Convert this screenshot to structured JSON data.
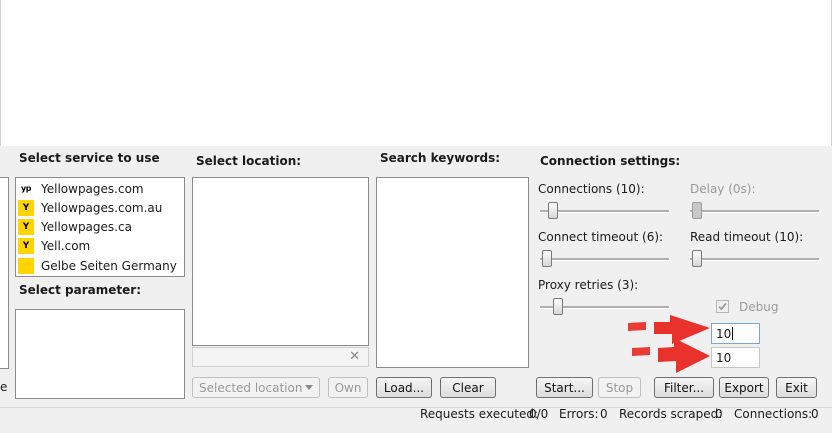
{
  "services": {
    "title": "Select service to use",
    "items": [
      {
        "label": "Yellowpages.com",
        "icon": "yellowpages-logo-icon",
        "glyph": "yp"
      },
      {
        "label": "Yellowpages.com.au",
        "icon": "yellowpages-au-logo-icon",
        "glyph": "Y"
      },
      {
        "label": "Yellowpages.ca",
        "icon": "yellowpages-ca-logo-icon",
        "glyph": "Y"
      },
      {
        "label": "Yell.com",
        "icon": "yell-logo-icon",
        "glyph": "Y"
      },
      {
        "label": "Gelbe Seiten Germany",
        "icon": "gelbe-seiten-logo-icon",
        "glyph": ""
      }
    ]
  },
  "parameter": {
    "title": "Select parameter:",
    "edge_char": "e"
  },
  "location": {
    "title": "Select location:",
    "clear_glyph": "✕",
    "dropdown_placeholder": "Selected location",
    "own_label": "Own"
  },
  "keywords": {
    "title": "Search keywords:",
    "load_label": "Load...",
    "clear_label": "Clear"
  },
  "connection": {
    "title": "Connection settings:",
    "connections_label": "Connections (10):",
    "delay_label": "Delay (0s):",
    "connect_timeout_label": "Connect timeout (6):",
    "read_timeout_label": "Read timeout (10):",
    "proxy_retries_label": "Proxy retries (3):",
    "debug_label": "Debug",
    "debug_checked": true,
    "spin1_value": "10",
    "spin2_value": "10"
  },
  "actions": {
    "start_label": "Start...",
    "stop_label": "Stop",
    "filter_label": "Filter...",
    "export_label": "Export",
    "exit_label": "Exit"
  },
  "status": {
    "requests_label": "Requests executed:",
    "requests_value": "0/0",
    "errors_label": "Errors:",
    "errors_value": "0",
    "records_label": "Records scraped:",
    "records_value": "0",
    "connections_label": "Connections:",
    "connections_value": "0"
  },
  "colors": {
    "annotation_arrow": "#e8322b",
    "panel_bg": "#f0f0f0",
    "yellow_brand": "#ffd400"
  }
}
